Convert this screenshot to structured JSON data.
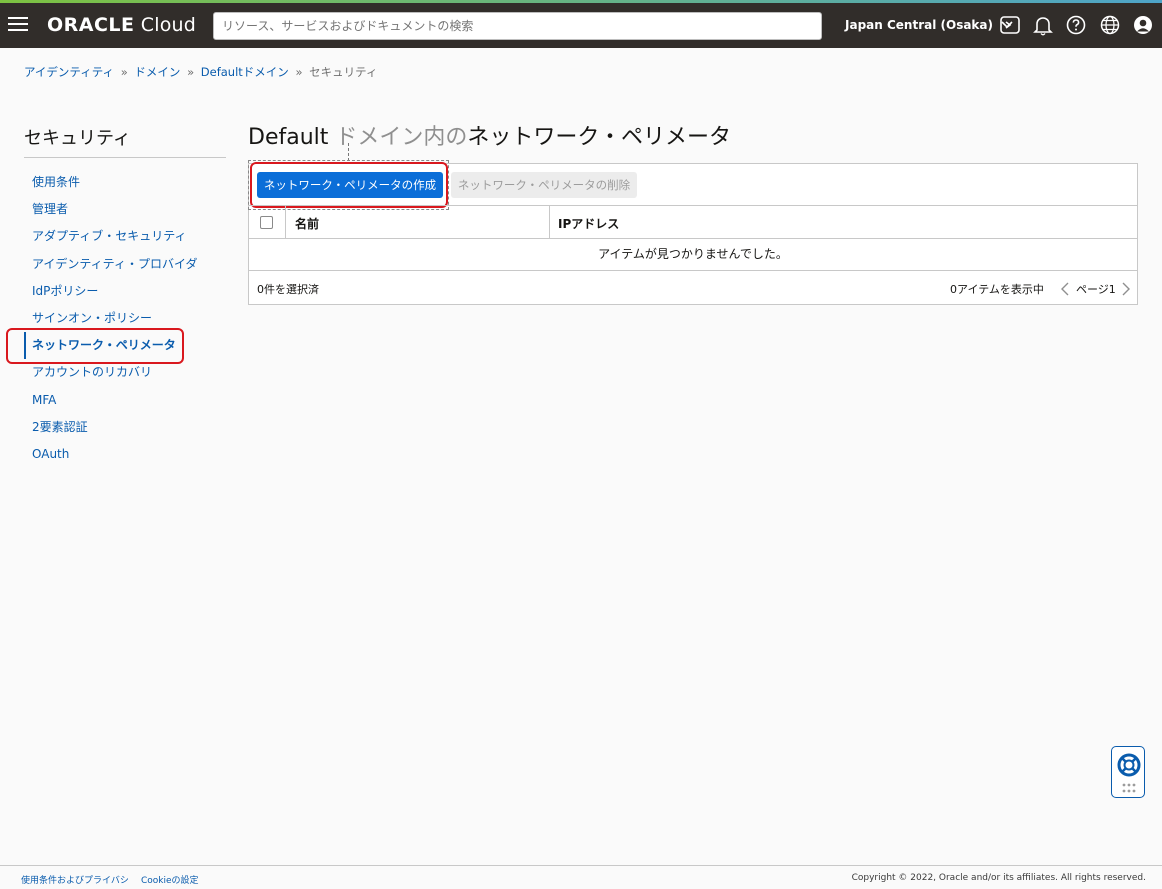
{
  "header": {
    "logo_brand": "ORACLE",
    "logo_product": "Cloud",
    "search_placeholder": "リソース、サービスおよびドキュメントの検索",
    "region": "Japan Central (Osaka)"
  },
  "breadcrumb": {
    "items": [
      "アイデンティティ",
      "ドメイン",
      "Defaultドメイン"
    ],
    "current": "セキュリティ",
    "separator": "»"
  },
  "sidebar": {
    "title": "セキュリティ",
    "items": [
      {
        "label": "使用条件"
      },
      {
        "label": "管理者"
      },
      {
        "label": "アダプティブ・セキュリティ"
      },
      {
        "label": "アイデンティティ・プロバイダ"
      },
      {
        "label": "IdPポリシー"
      },
      {
        "label": "サインオン・ポリシー"
      },
      {
        "label": "ネットワーク・ペリメータ",
        "active": true
      },
      {
        "label": "アカウントのリカバリ"
      },
      {
        "label": "MFA"
      },
      {
        "label": "2要素認証"
      },
      {
        "label": "OAuth"
      }
    ]
  },
  "main": {
    "title_prefix": "Default",
    "title_middle": "ドメイン内の",
    "title_suffix": "ネットワーク・ペリメータ",
    "create_button": "ネットワーク・ペリメータの作成",
    "delete_button": "ネットワーク・ペリメータの削除",
    "table": {
      "columns": [
        "名前",
        "IPアドレス"
      ],
      "empty_message": "アイテムが見つかりませんでした。",
      "selected_count": "0件を選択済",
      "item_count": "0アイテムを表示中",
      "page_label": "ページ1"
    }
  },
  "footer": {
    "links": [
      "使用条件およびプライバシ",
      "Cookieの設定"
    ],
    "copyright": "Copyright © 2022, Oracle and/or its affiliates. All rights reserved."
  },
  "colors": {
    "header_bg": "#312d2a",
    "primary": "#0b6ed8",
    "link": "#0a5cad",
    "highlight": "#d9181e"
  }
}
